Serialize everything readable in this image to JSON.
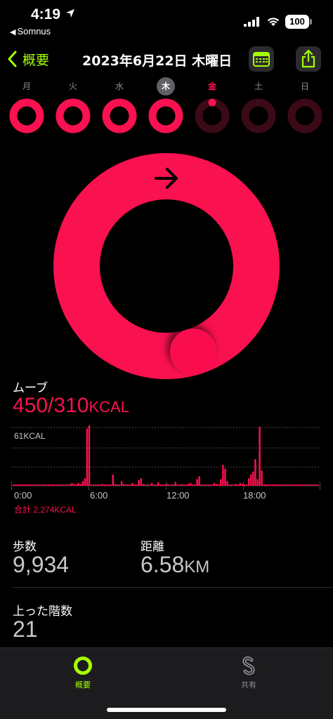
{
  "status_bar": {
    "time": "4:19",
    "back_app": "Somnus",
    "battery": "100"
  },
  "nav": {
    "back_label": "概要",
    "title": "2023年6月22日 木曜日"
  },
  "week": {
    "days": [
      {
        "label": "月",
        "progress": 1.0,
        "state": "normal"
      },
      {
        "label": "火",
        "progress": 1.0,
        "state": "normal"
      },
      {
        "label": "水",
        "progress": 1.0,
        "state": "normal"
      },
      {
        "label": "木",
        "progress": 1.0,
        "state": "today"
      },
      {
        "label": "金",
        "progress": 0.0,
        "state": "selected"
      },
      {
        "label": "土",
        "progress": 0.0,
        "state": "future"
      },
      {
        "label": "日",
        "progress": 0.0,
        "state": "future"
      }
    ]
  },
  "move_ring": {
    "progress": 1.45
  },
  "move": {
    "title": "ムーブ",
    "value": "450/310",
    "unit": "KCAL"
  },
  "chart_data": {
    "type": "bar",
    "top_label": "61KCAL",
    "x_ticks": [
      "0:00",
      "6:00",
      "12:00",
      "18:00"
    ],
    "x_range_hours": [
      0,
      24
    ],
    "y_max": 61,
    "total_label": "合計 2,274KCAL",
    "values": [
      1,
      1,
      1,
      1,
      1,
      1,
      1,
      1,
      1,
      1,
      1,
      1,
      1,
      1,
      1,
      1,
      1,
      1,
      1,
      1,
      1,
      1,
      1,
      1,
      1,
      1,
      2,
      3,
      2,
      1,
      3,
      2,
      5,
      8,
      60,
      65,
      1,
      1,
      1,
      1,
      1,
      2,
      1,
      1,
      1,
      1,
      12,
      2,
      1,
      1,
      5,
      2,
      1,
      1,
      1,
      3,
      1,
      1,
      6,
      8,
      2,
      1,
      1,
      1,
      3,
      1,
      1,
      4,
      1,
      1,
      1,
      2,
      1,
      1,
      1,
      4,
      1,
      1,
      2,
      1,
      1,
      2,
      3,
      1,
      1,
      7,
      10,
      1,
      1,
      1,
      1,
      1,
      1,
      3,
      2,
      1,
      7,
      22,
      18,
      5,
      1,
      1,
      1,
      2,
      1,
      3,
      2,
      1,
      1,
      8,
      12,
      15,
      28,
      7,
      62,
      16,
      1,
      1,
      1,
      1,
      1,
      1,
      1,
      1,
      1,
      1,
      1,
      1,
      1,
      1,
      1,
      1,
      1,
      1,
      1,
      1,
      1,
      1,
      1,
      1,
      1,
      1
    ],
    "color": "#fa114f"
  },
  "metrics": {
    "steps_title": "歩数",
    "steps_value": "9,934",
    "distance_title": "距離",
    "distance_value": "6.58",
    "distance_unit": "KM",
    "floors_title": "上った階数",
    "floors_value": "21"
  },
  "tabs": [
    {
      "label": "概要",
      "active": true
    },
    {
      "label": "共有",
      "active": false
    }
  ],
  "colors": {
    "accent": "#a6ff00",
    "move": "#fa114f",
    "move_dark": "#3a0a16"
  }
}
